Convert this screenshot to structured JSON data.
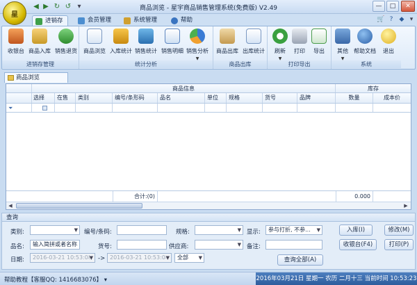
{
  "window": {
    "title": "商品浏览 - 星宇商品销售管理系统(免费版) V2.49",
    "app_badge": "星"
  },
  "tabs": [
    {
      "label": "进销存",
      "active": true
    },
    {
      "label": "会员管理",
      "active": false
    },
    {
      "label": "系统管理",
      "active": false
    },
    {
      "label": "帮助",
      "active": false
    }
  ],
  "ribbon": {
    "groups": [
      {
        "label": "进销存管理",
        "buttons": [
          "收银台",
          "商品入库",
          "销售退货"
        ]
      },
      {
        "label": "统计分析",
        "buttons": [
          "商品浏览",
          "入库统计",
          "销售统计",
          "销售明细",
          "销售分析"
        ]
      },
      {
        "label": "商品出库",
        "buttons": [
          "商品出库",
          "出库统计"
        ]
      },
      {
        "label": "打印导出",
        "buttons": [
          "刷新",
          "打印",
          "导出"
        ]
      },
      {
        "label": "系统",
        "buttons": [
          "其他",
          "帮助文档",
          "退出"
        ]
      }
    ]
  },
  "doc_tab": {
    "label": "商品浏览"
  },
  "grid": {
    "group_headers": {
      "info": "商品信息",
      "stock": "库存"
    },
    "columns": [
      "选择",
      "在售",
      "类别",
      "编号/条形码",
      "品名",
      "单位",
      "规格",
      "货号",
      "品牌",
      "数量",
      "成本价"
    ],
    "footer_sum": "合计:(0)",
    "footer_qty": "0.000"
  },
  "query": {
    "title": "查询",
    "labels": {
      "category": "类别:",
      "code": "编号/条码:",
      "spec": "规格:",
      "display": "显示:",
      "name": "品名:",
      "item_no": "货号:",
      "supplier": "供应商:",
      "note": "备注:",
      "date": "日期:",
      "arrow": "->"
    },
    "values": {
      "display": "参与打折, 不参...",
      "name": "输入简拼或者名称",
      "date_from": "2016-03-21 10:53:08",
      "date_to": "2016-03-21 10:53:08",
      "range": "全部"
    },
    "buttons": {
      "query_all": "查询全部(A)",
      "stock_in": "入库(I)",
      "modify": "修改(M)",
      "cashier": "收银台(F4)",
      "print": "打印(P)"
    }
  },
  "status": {
    "help": "帮助教程【客服QQ: 1416683076】",
    "datetime": "2016年03月21日 星期一 农历 二月十三 当前时间 10:53:23"
  }
}
